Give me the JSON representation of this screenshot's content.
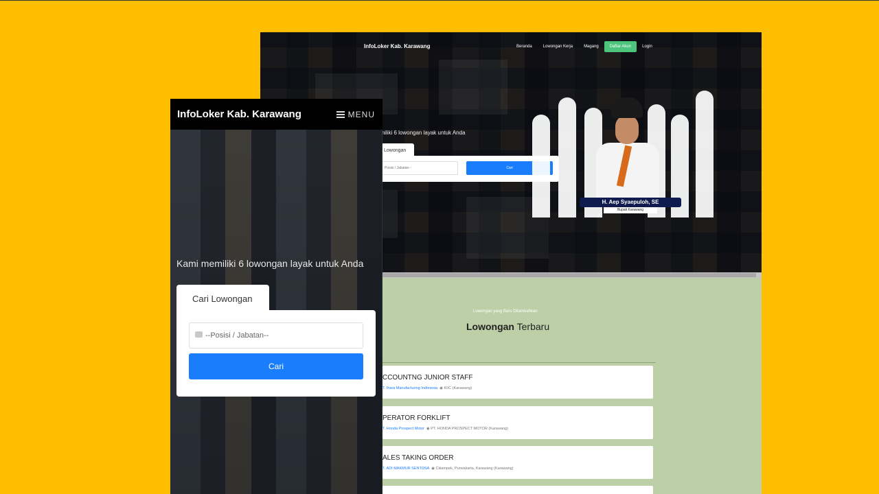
{
  "desktop": {
    "brand": "InfoLoker Kab. Karawang",
    "nav": [
      "Beranda",
      "Lowongan Kerja",
      "Magang",
      "Daftar Akun",
      "Login"
    ],
    "tagline": "emiliki 6 lowongan layak untuk Anda",
    "search_tab": "Lowongan",
    "search_placeholder": "Posisi / Jabatan--",
    "search_button": "Cari",
    "official_name": "H. Aep Syaepuloh, SE",
    "official_title": "Bupati Karawang",
    "section_subtitle": "Lowongan yang Baru Ditambahkan",
    "section_title_bold": "Lowongan",
    "section_title_rest": " Terbaru",
    "jobs": [
      {
        "title": "CCOUNTNG JUNIOR STAFF",
        "company": "T. Ihara Manufacturing Indonesia",
        "location": "KIIC (Karawang)"
      },
      {
        "title": "PERATOR FORKLIFT",
        "company": "T. Honda Prospect Motor",
        "location": "PT. HONDA PROSPECT MOTOR (Karawang)"
      },
      {
        "title": "ALES TAKING ORDER",
        "company": "T. ADI MAKMUR SENTOSA",
        "location": "Cikampek, Purwakarta, Karawang (Karawang)"
      }
    ],
    "accent_button": "#1a7dfb",
    "accent_register": "#4cc47c"
  },
  "mobile": {
    "brand": "InfoLoker Kab. Karawang",
    "menu_label": "MENU",
    "tagline": "Kami memiliki 6 lowongan layak untuk Anda",
    "search_tab": "Cari Lowongan",
    "search_placeholder": "--Posisi / Jabatan--",
    "search_button": "Cari"
  }
}
